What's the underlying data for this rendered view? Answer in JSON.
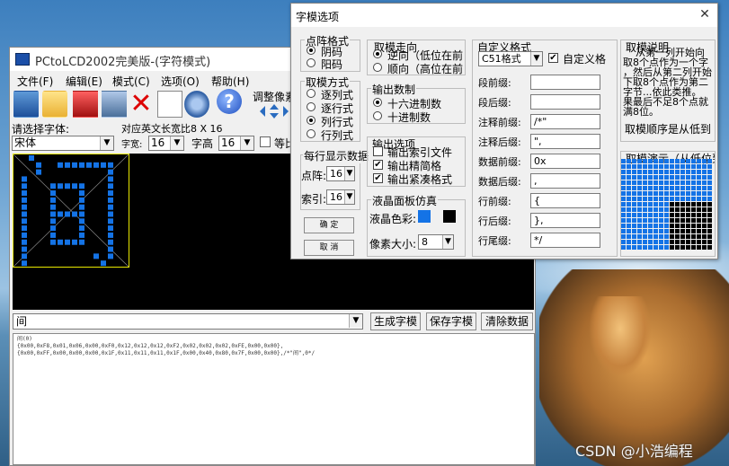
{
  "main": {
    "title": "PCtoLCD2002完美版-(字符模式)",
    "menu": [
      "文件(F)",
      "编辑(E)",
      "模式(C)",
      "选项(O)",
      "帮助(H)"
    ],
    "toolbar_pixel_label": "调整像素",
    "tb_help": "?",
    "tb_close": "✕",
    "font_label": "请选择字体:",
    "charsize_label": "对应英文长宽比8 X 16",
    "font_value": "宋体",
    "width_label": "字宽:",
    "width_value": "16",
    "height_label": "字高",
    "height_value": "16",
    "ratio_label": "等比",
    "input_value": "间",
    "gen_button": "生成字模",
    "save_button": "保存字模",
    "clear_button": "清除数据",
    "output_lines": [
      "间(0)",
      "",
      "{0x00,0xF8,0x01,0x06,0x00,0xF0,0x12,0x12,0x12,0xF2,0x02,0x02,0x02,0xFE,0x00,0x00},",
      "{0x00,0xFF,0x00,0x00,0x00,0x1F,0x11,0x11,0x11,0x1F,0x00,0x40,0x80,0x7F,0x00,0x00},/*\"间\",0*/"
    ]
  },
  "dialog": {
    "title": "字模选项",
    "close": "✕",
    "matrix": {
      "title": "点阵格式",
      "options": [
        "阴码",
        "阳码"
      ],
      "selected": 0
    },
    "mode": {
      "title": "取模方式",
      "options": [
        "逐列式",
        "逐行式",
        "列行式",
        "行列式"
      ],
      "selected": 2
    },
    "per_line": {
      "title": "每行显示数据",
      "dots_label": "点阵:",
      "dots_value": "16",
      "index_label": "索引:",
      "index_value": "16"
    },
    "ok_button": "确 定",
    "cancel_button": "取 消",
    "direction": {
      "title": "取模走向",
      "options": [
        "逆向（低位在前",
        "顺向（高位在前"
      ],
      "selected": 0
    },
    "number": {
      "title": "输出数制",
      "options": [
        "十六进制数",
        "十进制数"
      ],
      "selected": 0
    },
    "output_opts": {
      "title": "输出选项",
      "items": [
        {
          "label": "输出索引文件",
          "checked": false
        },
        {
          "label": "输出精简格",
          "checked": true
        },
        {
          "label": "输出紧凑格式",
          "checked": true
        }
      ]
    },
    "lcd": {
      "title": "液晶面板仿真",
      "color_label": "液晶色彩:",
      "pixel_label": "像素大小:",
      "pixel_value": "8",
      "color_blue": "#1473e6",
      "color_black": "#000000"
    },
    "custom": {
      "title": "自定义格式",
      "format_value": "C51格式",
      "custom_label": "自定义格",
      "custom_checked": true,
      "rows": [
        {
          "label": "段前缀:",
          "value": ""
        },
        {
          "label": "段后缀:",
          "value": ""
        },
        {
          "label": "注释前缀:",
          "value": "/*\""
        },
        {
          "label": "注释后缀:",
          "value": "\","
        },
        {
          "label": "数据前缀:",
          "value": "0x"
        },
        {
          "label": "数据后缀:",
          "value": ","
        },
        {
          "label": "行前缀:",
          "value": "{"
        },
        {
          "label": "行后缀:",
          "value": "},"
        },
        {
          "label": "行尾缀:",
          "value": "*/"
        }
      ]
    },
    "desc": {
      "title": "取模说明",
      "text_lines": [
        "从第一列开始向",
        "取8个点作为一个字",
        "，然后从第二列开始",
        "下取8个点作为第二",
        "字节...依此类推。",
        "果最后不足8个点就",
        "满8位。"
      ],
      "order": "取模顺序是从低到"
    },
    "demo": {
      "title": "取模演示（从低位到"
    }
  },
  "watermark": "CSDN @小浩编程"
}
